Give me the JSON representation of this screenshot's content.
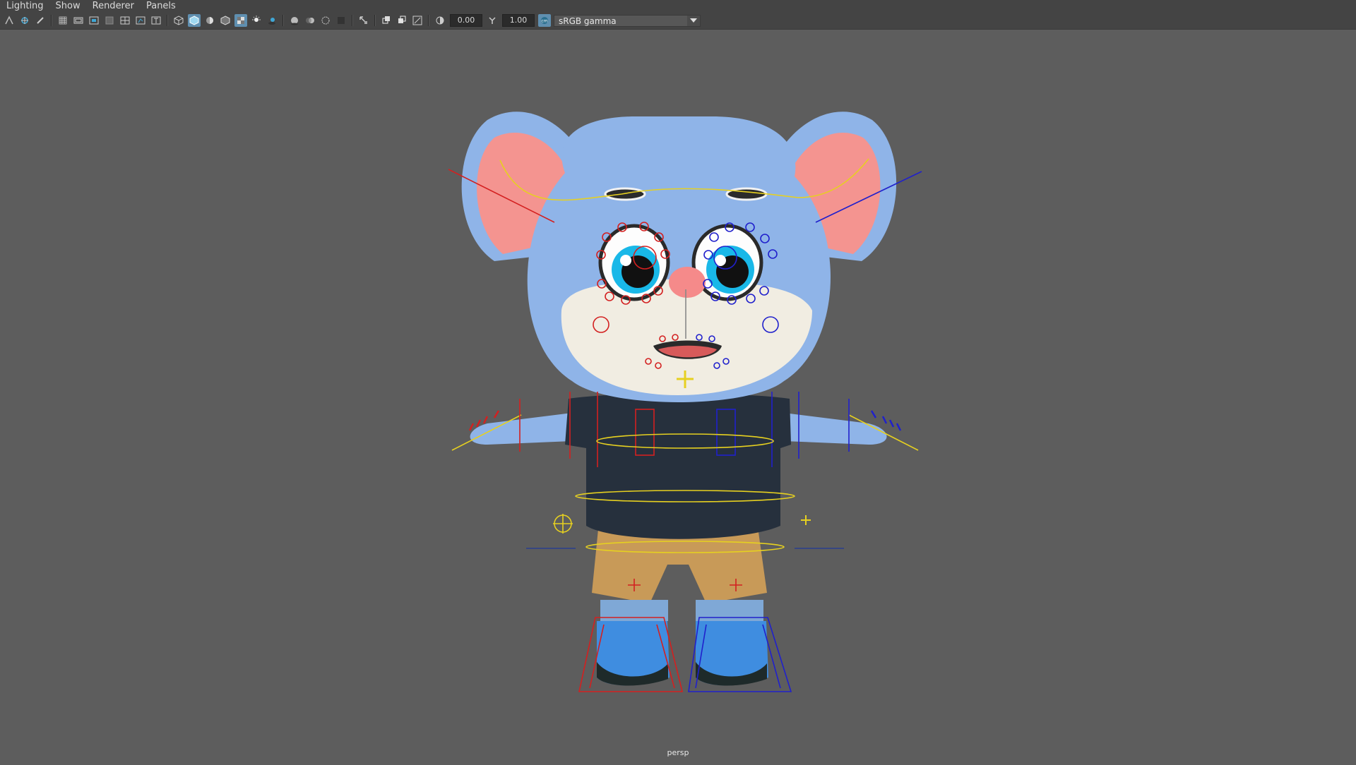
{
  "menu": [
    "Lighting",
    "Show",
    "Renderer",
    "Panels"
  ],
  "toolbar": {
    "exposure": "0.00",
    "gamma": "1.00",
    "color_space": "sRGB gamma"
  },
  "viewport": {
    "camera": "persp",
    "background": "#5d5d5d"
  },
  "character": {
    "fur_color": "#8fb4e8",
    "ear_inner": "#f49490",
    "shirt_color": "#26303d",
    "pants_color": "#c89a58",
    "shoe_color": "#3f8de0"
  }
}
